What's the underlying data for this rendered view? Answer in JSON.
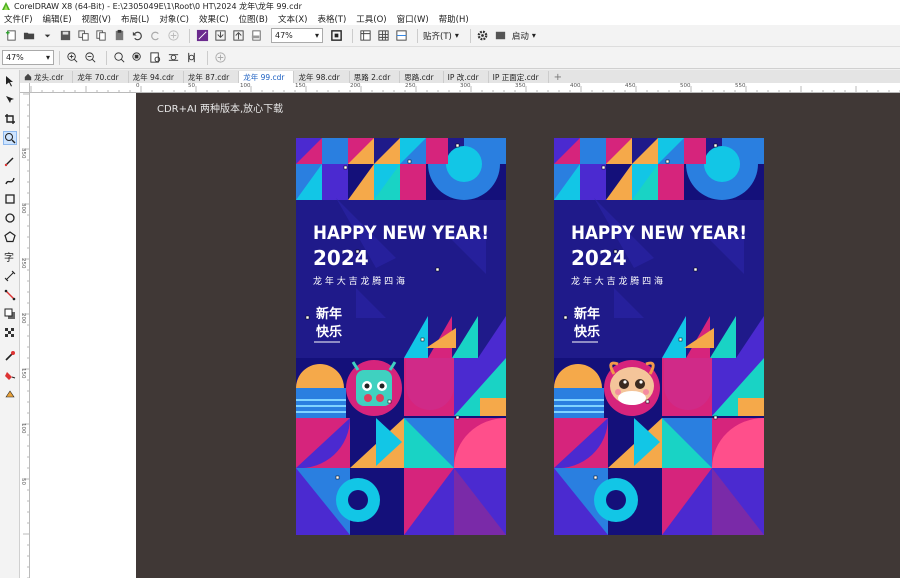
{
  "window": {
    "title": "CorelDRAW X8 (64-Bit) - E:\\2305049E\\1\\Root\\0 HT\\2024 龙年\\龙年 99.cdr"
  },
  "menu": {
    "items": [
      "文件(F)",
      "编辑(E)",
      "视图(V)",
      "布局(L)",
      "对象(C)",
      "效果(C)",
      "位图(B)",
      "文本(X)",
      "表格(T)",
      "工具(O)",
      "窗口(W)",
      "帮助(H)"
    ]
  },
  "toolbar": {
    "zoom_value": "47%",
    "snap_label": "贴齐(T)",
    "launch_label": "启动"
  },
  "property_bar": {
    "zoom_value": "47%"
  },
  "tabs": [
    "龙头.cdr",
    "龙年 70.cdr",
    "龙年 94.cdr",
    "龙年 87.cdr",
    "龙年 99.cdr",
    "龙年 98.cdr",
    "思路 2.cdr",
    "思路.cdr",
    "IP 改.cdr",
    "IP 正面定.cdr"
  ],
  "active_tab": "龙年 99.cdr",
  "rulers": {
    "h_ticks": [
      "0",
      "50",
      "100",
      "150",
      "200",
      "250",
      "300",
      "350",
      "400",
      "450",
      "500",
      "550"
    ],
    "v_ticks": [
      "350",
      "300",
      "250",
      "200",
      "150",
      "100",
      "50"
    ]
  },
  "canvas": {
    "watermark": "CDR+AI 两种版本,放心下载"
  },
  "posters": [
    {
      "headline": "HAPPY NEW YEAR!",
      "year": "2024",
      "tagline": "龙 年 大 吉   龙 腾 四 海",
      "stacked_1": "新年",
      "stacked_2": "快乐",
      "mascot": "teal-dragon"
    },
    {
      "headline": "HAPPY NEW YEAR!",
      "year": "2024",
      "tagline": "龙 年 大 吉   龙 腾 四 海",
      "stacked_1": "新年",
      "stacked_2": "快乐",
      "mascot": "cute-dragon"
    }
  ],
  "colors": {
    "canvas_bg": "#403836",
    "poster_navy": "#1f1a8a",
    "magenta": "#d6247c",
    "cyan": "#12c6e6",
    "teal": "#19d3c5",
    "orange": "#f5a94a",
    "blue": "#2a7fe0"
  }
}
